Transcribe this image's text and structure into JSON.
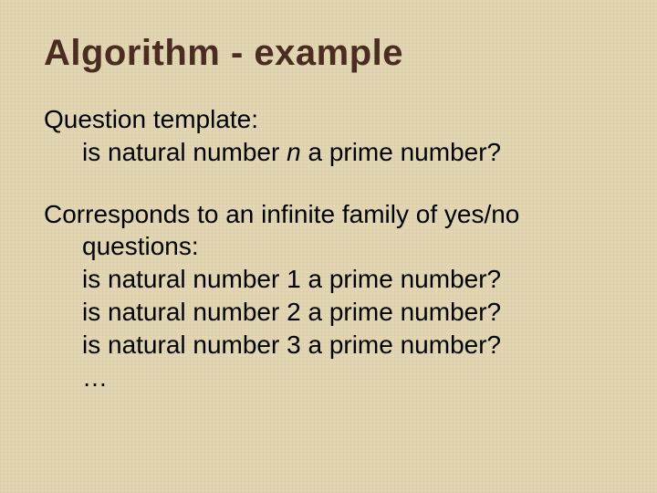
{
  "title": "Algorithm - example",
  "p1": {
    "lead": "Question template:",
    "line1_pre": "is natural number ",
    "line1_var": "n",
    "line1_post": " a prime number?"
  },
  "p2": {
    "lead": "Corresponds to an infinite family of yes/no",
    "lead2": "questions:",
    "q1": "is natural number 1 a prime number?",
    "q2": "is natural number 2 a prime number?",
    "q3": "is natural number 3 a prime number?",
    "ell": "…"
  }
}
